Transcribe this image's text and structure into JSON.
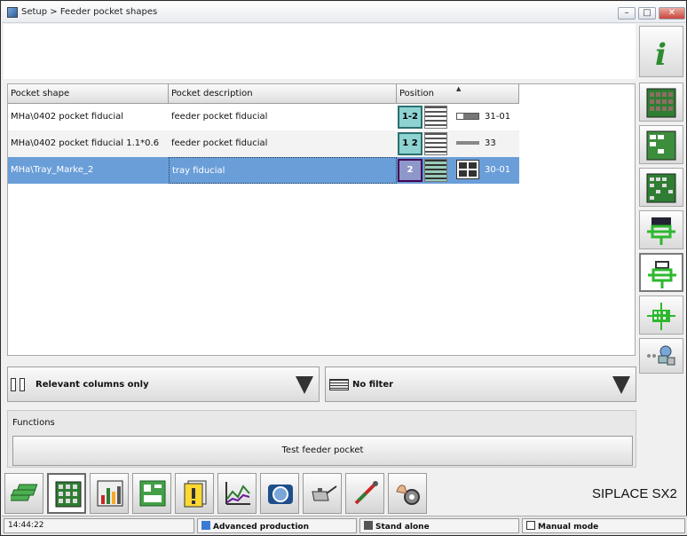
{
  "window": {
    "title": "Setup > Feeder pocket shapes"
  },
  "table": {
    "columns": [
      "Pocket shape",
      "Pocket description",
      "Position"
    ],
    "rows": [
      {
        "shape": "MHa\\0402 pocket fiducial",
        "description": "feeder pocket fiducial",
        "badge": "1-2",
        "pos": "31-01"
      },
      {
        "shape": "MHa\\0402 pocket fiducial 1.1*0.6",
        "description": "feeder pocket fiducial",
        "badge": "1 2",
        "pos": "33"
      },
      {
        "shape": "MHa\\Tray_Marke_2",
        "description": "tray fiducial",
        "badge": "2",
        "pos": "30-01"
      }
    ],
    "selected_row": 2
  },
  "filters": {
    "columns_label": "Relevant columns only",
    "filter_label": "No filter"
  },
  "functions": {
    "header": "Functions",
    "test_button": "Test feeder pocket"
  },
  "brand": "SIPLACE SX2",
  "status": {
    "time": "14:44:22",
    "production": "Advanced production",
    "mode_station": "Stand alone",
    "manual": "Manual mode"
  },
  "icons": {
    "right_toolbar": [
      "info-icon",
      "component-grid-icon",
      "component-list-icon",
      "component-matrix-icon",
      "feeder-green-icon",
      "feeder-pocket-icon",
      "tray-icon",
      "network-icon"
    ],
    "bottom_toolbar": [
      "stack-icon",
      "grid-icon",
      "bar-chart-icon",
      "board-icon",
      "alert-icon",
      "chart-icon",
      "camera-icon",
      "oil-can-icon",
      "tools-icon",
      "settings-hand-icon"
    ]
  },
  "colors": {
    "selection": "#6a9ed8",
    "badge": "#8fd2d2",
    "accent_green": "#2e8b2e"
  }
}
